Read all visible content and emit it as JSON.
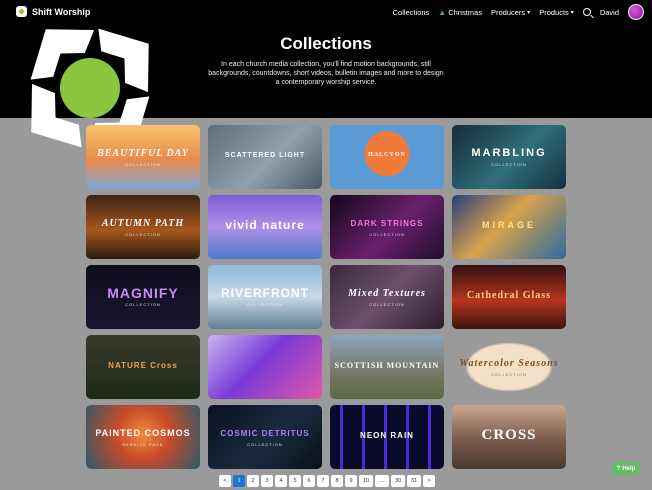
{
  "brand": {
    "name": "Shift Worship"
  },
  "nav": {
    "collections": "Collections",
    "christmas": "Christmas",
    "producers": "Producers",
    "products": "Products",
    "user": "David"
  },
  "header": {
    "title": "Collections",
    "subtitle": "In each church media collection, you'll find motion backgrounds, still backgrounds, countdowns, short videos, bulletin images and more to design a contemporary worship service."
  },
  "tiles": [
    {
      "title": "BEAUTIFUL DAY",
      "sub": "COLLECTION"
    },
    {
      "title": "SCATTERED LIGHT",
      "sub": ""
    },
    {
      "title": "HALCYON",
      "sub": ""
    },
    {
      "title": "MARBLING",
      "sub": "COLLECTION"
    },
    {
      "title": "AUTUMN PATH",
      "sub": "COLLECTION"
    },
    {
      "title": "vivid nature",
      "sub": ""
    },
    {
      "title": "DARK STRINGS",
      "sub": "COLLECTION"
    },
    {
      "title": "MIRAGE",
      "sub": ""
    },
    {
      "title": "MAGNIFY",
      "sub": "COLLECTION"
    },
    {
      "title": "RIVERFRONT",
      "sub": "COLLECTION"
    },
    {
      "title": "Mixed Textures",
      "sub": "COLLECTION"
    },
    {
      "title": "Cathedral Glass",
      "sub": ""
    },
    {
      "title": "NATURE Cross",
      "sub": ""
    },
    {
      "title": "",
      "sub": ""
    },
    {
      "title": "SCOTTISH MOUNTAIN",
      "sub": ""
    },
    {
      "title": "Watercolor Seasons",
      "sub": "COLLECTION"
    },
    {
      "title": "PAINTED COSMOS",
      "sub": "SERVICE PACK"
    },
    {
      "title": "COSMIC DETRITUS",
      "sub": "COLLECTION"
    },
    {
      "title": "NEON RAIN",
      "sub": ""
    },
    {
      "title": "CROSS",
      "sub": ""
    }
  ],
  "pagination": [
    "<",
    "1",
    "2",
    "3",
    "4",
    "5",
    "6",
    "7",
    "8",
    "9",
    "10",
    "...",
    "30",
    "31",
    ">"
  ],
  "help": {
    "label": "Help"
  }
}
